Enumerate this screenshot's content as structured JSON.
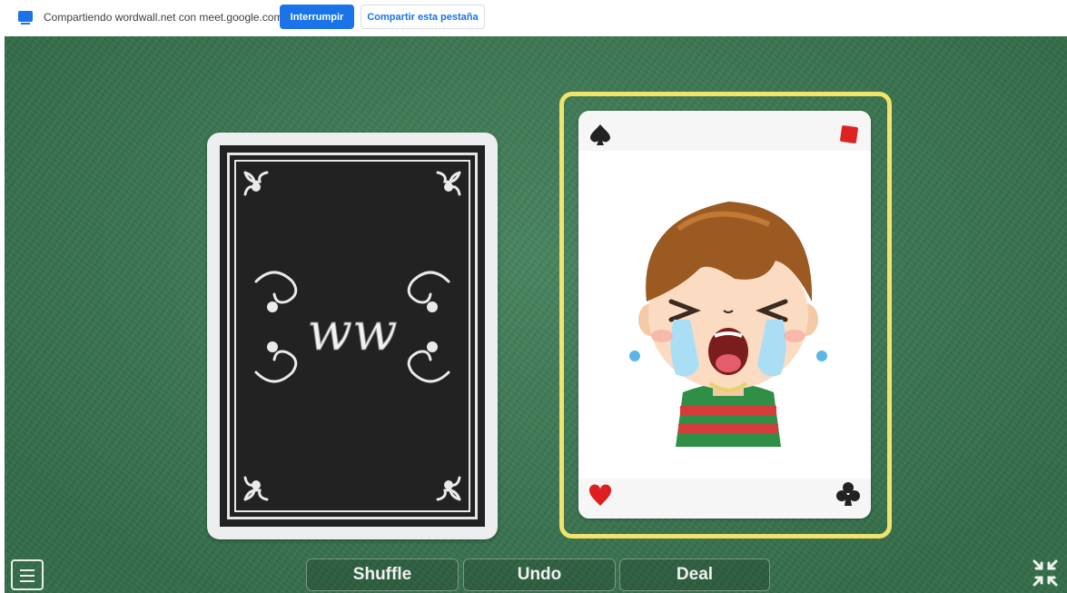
{
  "sharebar": {
    "text": "Compartiendo wordwall.net con meet.google.com",
    "stop_label": "Interrumpir",
    "share_tab_label": "Compartir esta pestaña",
    "icon": "screen-share-icon",
    "accent": "#1a73e8"
  },
  "game": {
    "background": "#3d7d55",
    "highlight_color": "#f2e36a",
    "deck_logo": "ww",
    "card": {
      "suits": [
        "spade",
        "diamond",
        "heart",
        "club"
      ],
      "image": "crying-boy"
    }
  },
  "controls": {
    "menu_icon": "menu-icon",
    "shuffle_label": "Shuffle",
    "undo_label": "Undo",
    "deal_label": "Deal",
    "fullscreen_icon": "exit-fullscreen-icon"
  }
}
